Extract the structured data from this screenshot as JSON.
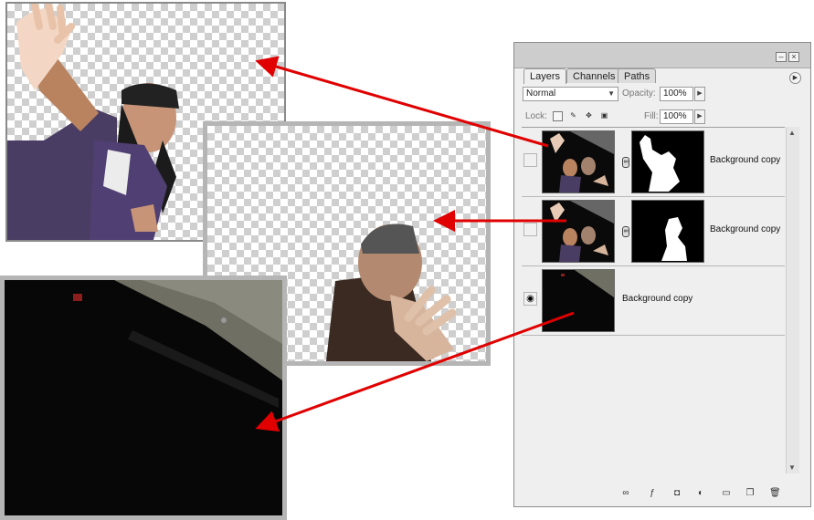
{
  "panel": {
    "tabs": [
      "Layers",
      "Channels",
      "Paths"
    ],
    "blend_mode": "Normal",
    "opacity_label": "Opacity:",
    "opacity_value": "100%",
    "lock_label": "Lock:",
    "fill_label": "Fill:",
    "fill_value": "100%",
    "layers": [
      {
        "name": "Background copy",
        "visible": false,
        "has_mask": true
      },
      {
        "name": "Background copy",
        "visible": false,
        "has_mask": true
      },
      {
        "name": "Background copy",
        "visible": true,
        "has_mask": false
      }
    ],
    "footer_icons": [
      "link-layers-icon",
      "layer-style-icon",
      "add-mask-icon",
      "adjustment-layer-icon",
      "new-group-icon",
      "new-layer-icon",
      "delete-layer-icon"
    ]
  },
  "colors": {
    "arrow": "#e00000",
    "panel_bg": "#efefef"
  }
}
